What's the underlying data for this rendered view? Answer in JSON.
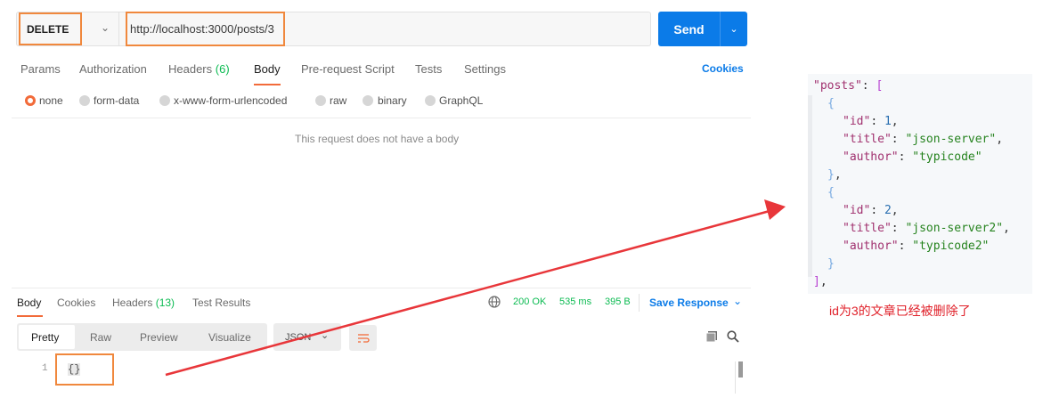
{
  "request": {
    "method": "DELETE",
    "url": "http://localhost:3000/posts/3",
    "send_label": "Send"
  },
  "request_tabs": {
    "params": "Params",
    "authorization": "Authorization",
    "headers": "Headers",
    "headers_count": "(6)",
    "body": "Body",
    "prerequest": "Pre-request Script",
    "tests": "Tests",
    "settings": "Settings",
    "cookies": "Cookies"
  },
  "body_types": {
    "none": "none",
    "form_data": "form-data",
    "urlencoded": "x-www-form-urlencoded",
    "raw": "raw",
    "binary": "binary",
    "graphql": "GraphQL"
  },
  "no_body_text": "This request does not have a body",
  "response_tabs": {
    "body": "Body",
    "cookies": "Cookies",
    "headers": "Headers",
    "headers_count": "(13)",
    "test_results": "Test Results"
  },
  "response_status": {
    "status": "200 OK",
    "time": "535 ms",
    "size": "395 B",
    "save_response": "Save Response"
  },
  "view_modes": {
    "pretty": "Pretty",
    "raw": "Raw",
    "preview": "Preview",
    "visualize": "Visualize"
  },
  "format": "JSON",
  "response_body": {
    "line_number": "1",
    "content": "{}"
  },
  "json_panel": {
    "l1_key": "\"posts\"",
    "l1_sep": ": ",
    "l1_open": "[",
    "open_obj": "{",
    "close_obj": "}",
    "comma": ",",
    "id_key": "\"id\"",
    "title_key": "\"title\"",
    "author_key": "\"author\"",
    "colon": ": ",
    "obj1_id": "1",
    "obj1_title": "\"json-server\"",
    "obj1_author": "\"typicode\"",
    "obj2_id": "2",
    "obj2_title": "\"json-server2\"",
    "obj2_author": "\"typicode2\"",
    "close_arr": "]"
  },
  "annotation": "id为3的文章已经被删除了",
  "colors": {
    "accent": "#f26b3a",
    "highlight_box": "#f0883d",
    "send": "#0b7be8",
    "status_ok": "#0cbb52",
    "arrow": "#e8363a"
  },
  "icons": {
    "method_dropdown": "chevron-down-icon",
    "send_dropdown": "chevron-down-icon",
    "globe": "globe-icon",
    "save_dropdown": "chevron-down-icon",
    "format_dropdown": "chevron-down-icon",
    "wrap": "wrap-lines-icon",
    "copy": "copy-icon",
    "search": "search-icon"
  }
}
